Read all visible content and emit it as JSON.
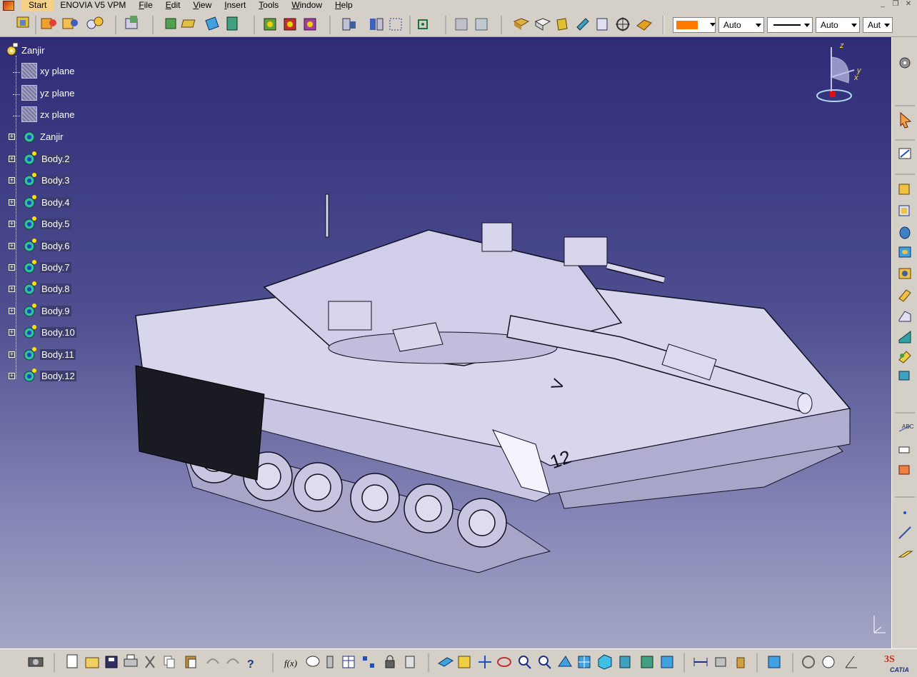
{
  "menubar": {
    "items": [
      {
        "label": "Start",
        "name": "menu-start"
      },
      {
        "label": "ENOVIA V5 VPM",
        "name": "menu-enovia"
      },
      {
        "label": "File",
        "name": "menu-file"
      },
      {
        "label": "Edit",
        "name": "menu-edit"
      },
      {
        "label": "View",
        "name": "menu-view"
      },
      {
        "label": "Insert",
        "name": "menu-insert"
      },
      {
        "label": "Tools",
        "name": "menu-tools"
      },
      {
        "label": "Window",
        "name": "menu-window"
      },
      {
        "label": "Help",
        "name": "menu-help"
      }
    ]
  },
  "properties_toolbar": {
    "fill_color": "#ff7a00",
    "line_thickness": "Auto",
    "line_weight": "Auto",
    "layer": "Aut"
  },
  "tree": {
    "root": "Zanjir",
    "planes": [
      "xy plane",
      "yz plane",
      "zx plane"
    ],
    "bodies": [
      "Zanjir",
      "Body.2",
      "Body.3",
      "Body.4",
      "Body.5",
      "Body.6",
      "Body.7",
      "Body.8",
      "Body.9",
      "Body.10",
      "Body.11",
      "Body.12"
    ]
  },
  "compass": {
    "z": "z",
    "y": "y",
    "x": "x"
  },
  "model": {
    "hull_number": "12",
    "side_mark": "V"
  },
  "colors": {
    "background_top": "#2e2c76",
    "background_bottom": "#a4a6c4",
    "tank_body": "#d8d6ec",
    "accent": "#ff7a00"
  },
  "bottom_toolbar": {
    "brand": "CATIA"
  }
}
